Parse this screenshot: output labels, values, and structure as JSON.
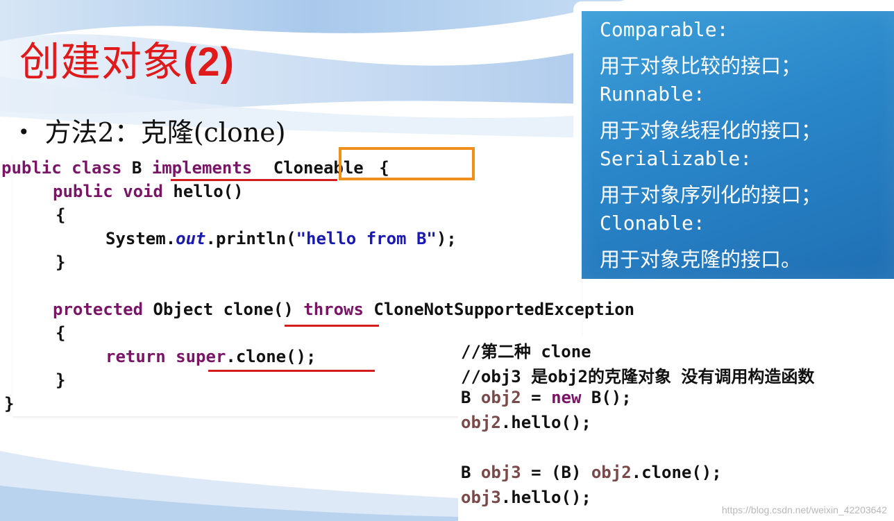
{
  "slide": {
    "title_text": "创建对象",
    "title_num": "(2)",
    "bullet": "方法2：克隆(clone)"
  },
  "code": {
    "l1": {
      "kw": "public class ",
      "cls": "B ",
      "impl": "implements ",
      "iface": "Cloneable",
      "brace": " {"
    },
    "l2": {
      "kw": "public void ",
      "rest": "hello()"
    },
    "l3": "{",
    "l4": {
      "pre": "System.",
      "field": "out",
      "call": ".println(",
      "str": "\"hello from B\"",
      "end": ");"
    },
    "l5": "}",
    "l6": {
      "kw": "protected ",
      "type": "Object ",
      "method": "clone()",
      "throws": " throws ",
      "exc": "CloneNotSupportedException"
    },
    "l7": "{",
    "l8": {
      "kw": "return ",
      "sup": "super",
      "rest": ".clone();"
    },
    "l9": "}",
    "l10": "}"
  },
  "info": {
    "items": [
      {
        "term": "Comparable:",
        "desc": "用于对象比较的接口；"
      },
      {
        "term": "Runnable:",
        "desc": "用于对象线程化的接口；"
      },
      {
        "term": "Serializable:",
        "desc": "用于对象序列化的接口；"
      },
      {
        "term": "Clonable:",
        "desc": "用于对象克隆的接口。"
      }
    ]
  },
  "snippet": {
    "c1": "//第二种 clone",
    "c2": "//obj3 是obj2的克隆对象 没有调用构造函数",
    "s3": {
      "a": "B ",
      "v": "obj2",
      "b": " = ",
      "kw": "new",
      "c": " B();"
    },
    "s4": {
      "v": "obj2",
      "rest": ".hello();"
    },
    "s5": {
      "a": "B ",
      "v": "obj3",
      "b": " = (B) ",
      "v2": "obj2",
      "rest": ".clone();"
    },
    "s6": {
      "v": "obj3",
      "rest": ".hello();"
    }
  },
  "watermark": "https://blog.csdn.net/weixin_42203642",
  "colors": {
    "title": "#e01a1a",
    "info_bg": "#2a86c9",
    "highlight_box": "#f0901c",
    "underline": "#d41c1c"
  }
}
